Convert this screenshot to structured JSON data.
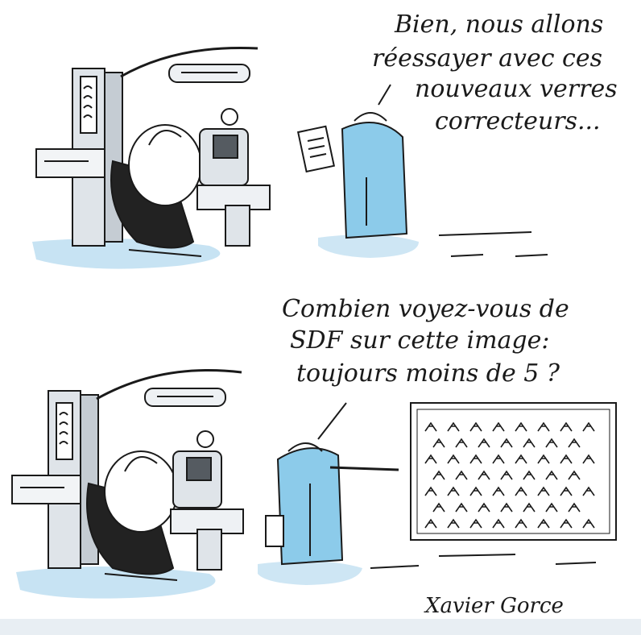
{
  "panel_top": {
    "speech_lines": [
      "Bien, nous allons",
      "réessayer avec ces",
      "nouveaux verres",
      "correcteurs..."
    ]
  },
  "panel_bottom": {
    "speech_lines": [
      "Combien voyez-vous de",
      "SDF sur cette image:",
      "toujours moins de 5 ?"
    ]
  },
  "signature": "Xavier Gorce",
  "colors": {
    "ink": "#1a1a1a",
    "coat_blue": "#8ccbea",
    "shadow_blue": "#b9dcf0",
    "chair_grey": "#c5ccd3",
    "chair_black": "#222222"
  }
}
